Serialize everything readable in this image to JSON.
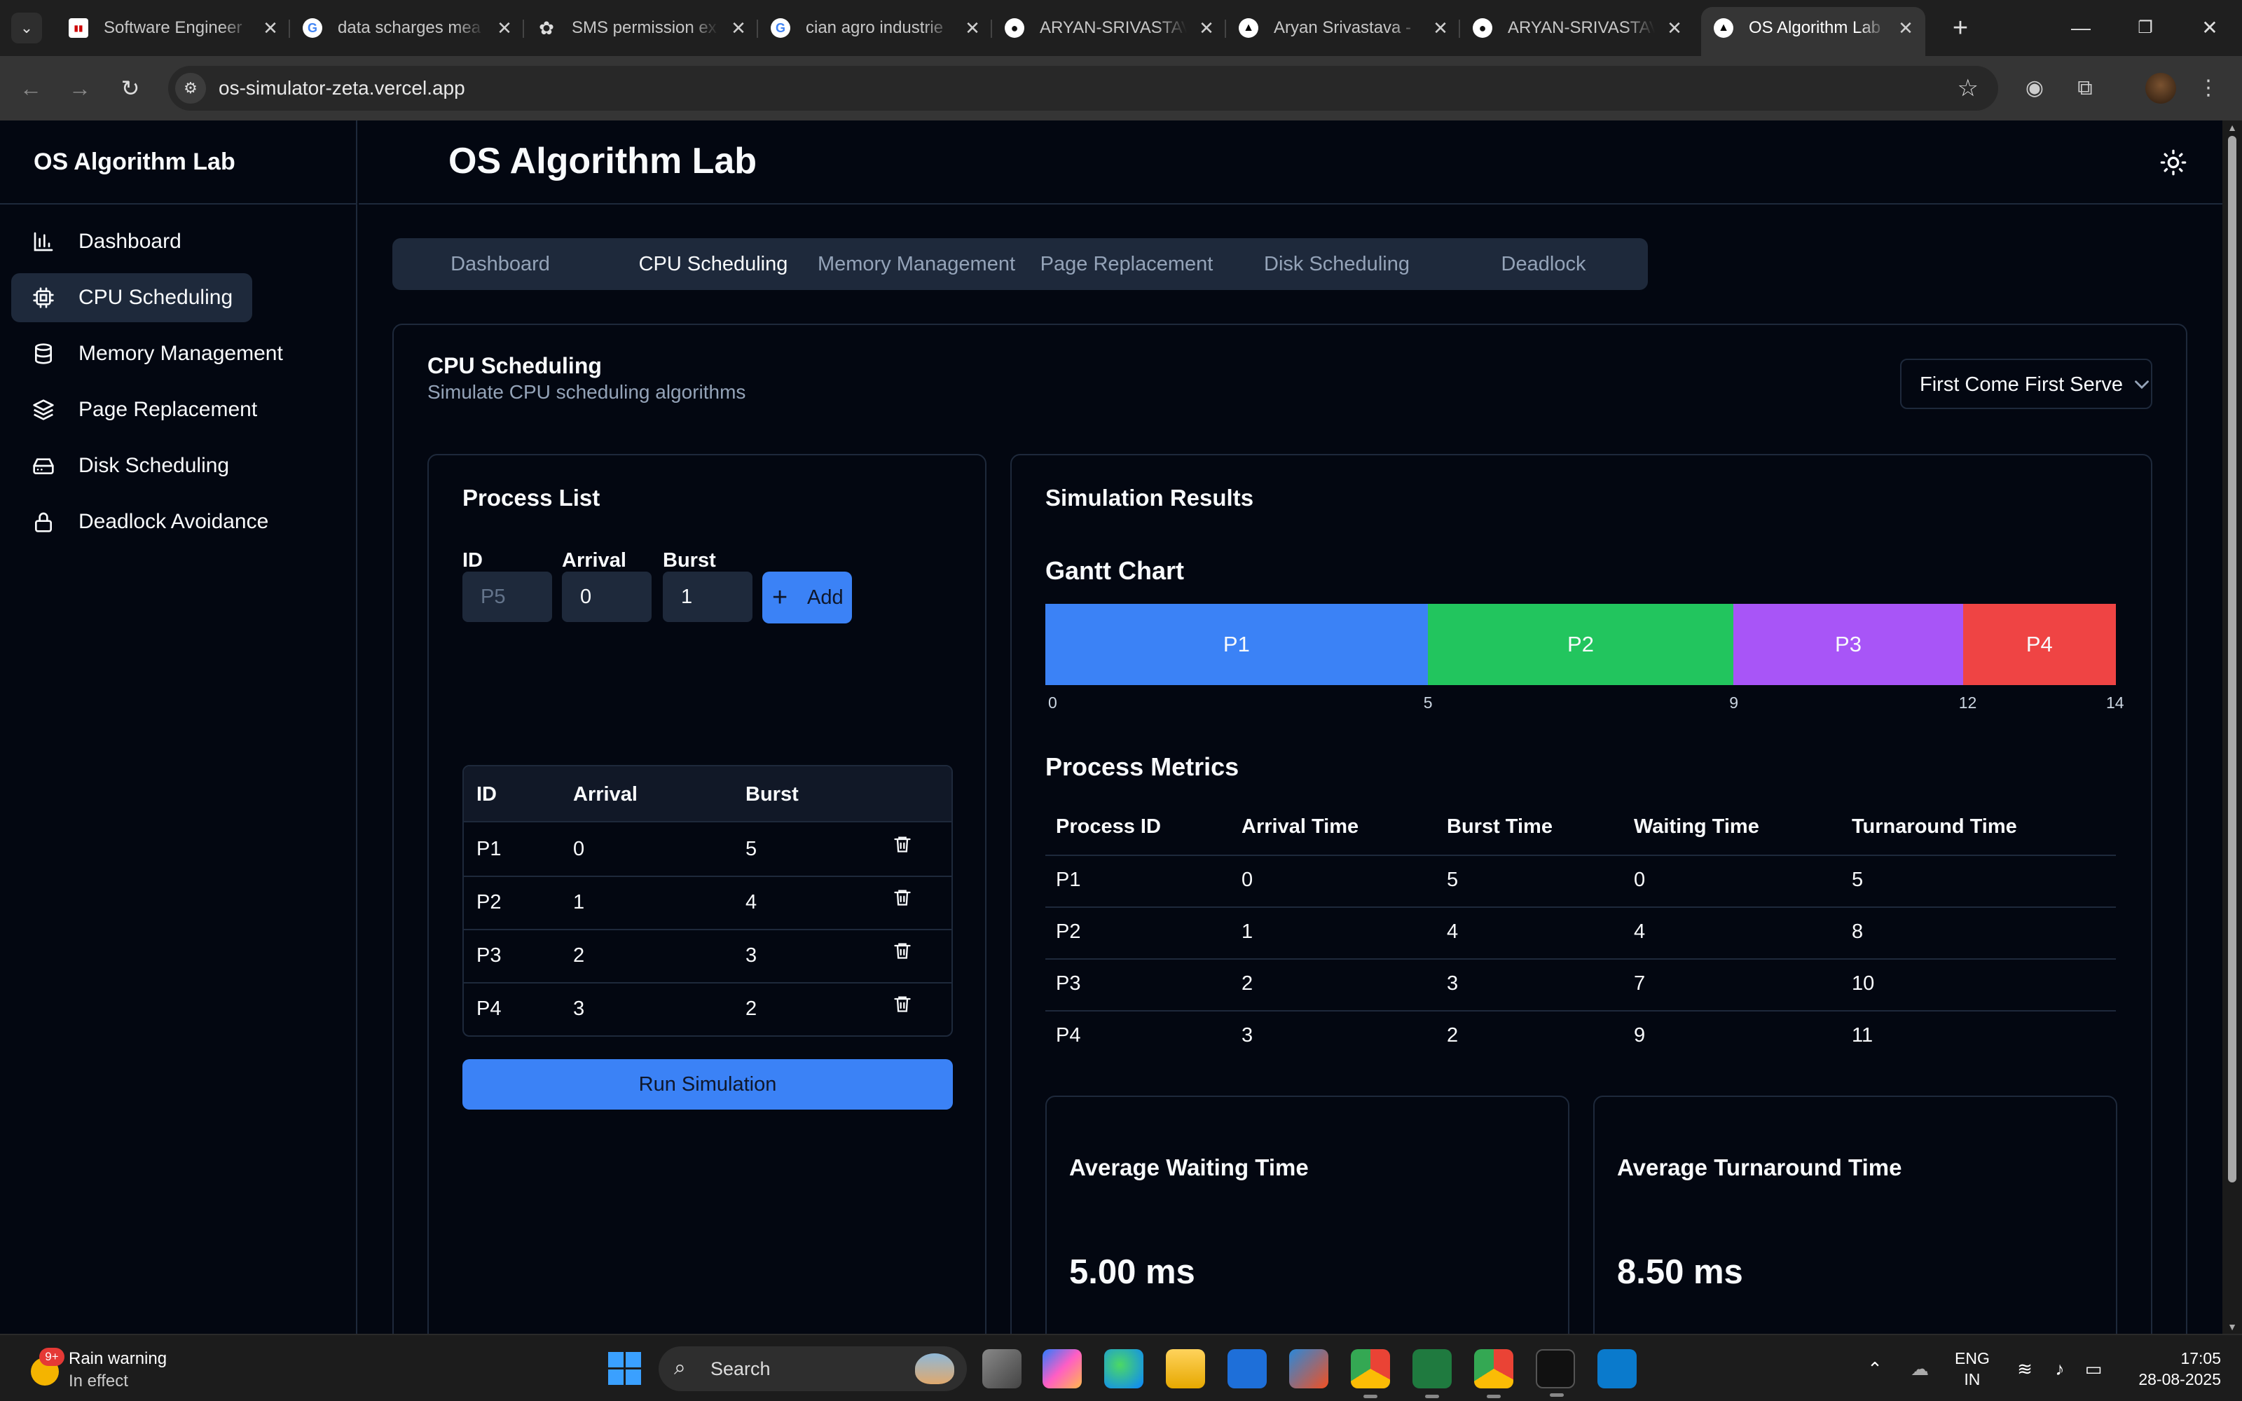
{
  "browser": {
    "tabs": [
      {
        "title": "Software Engineer",
        "favicon": "cisco-icon"
      },
      {
        "title": "data scharges mea",
        "favicon": "google-icon"
      },
      {
        "title": "SMS permission ex",
        "favicon": "openai-icon"
      },
      {
        "title": "cian agro industrie",
        "favicon": "google-icon"
      },
      {
        "title": "ARYAN-SRIVASTAV",
        "favicon": "github-icon"
      },
      {
        "title": "Aryan Srivastava -",
        "favicon": "vercel-icon"
      },
      {
        "title": "ARYAN-SRIVASTAV",
        "favicon": "github-icon"
      },
      {
        "title": "OS Algorithm Lab",
        "favicon": "vercel-icon",
        "active": true
      }
    ],
    "url": "os-simulator-zeta.vercel.app"
  },
  "sidebar": {
    "brand": "OS Algorithm Lab",
    "items": [
      {
        "label": "Dashboard",
        "icon": "bar-chart-icon"
      },
      {
        "label": "CPU Scheduling",
        "icon": "cpu-icon",
        "active": true
      },
      {
        "label": "Memory Management",
        "icon": "database-icon"
      },
      {
        "label": "Page Replacement",
        "icon": "layers-icon"
      },
      {
        "label": "Disk Scheduling",
        "icon": "hard-drive-icon"
      },
      {
        "label": "Deadlock Avoidance",
        "icon": "lock-icon"
      }
    ]
  },
  "header": {
    "title": "OS Algorithm Lab"
  },
  "tabs": [
    {
      "label": "Dashboard"
    },
    {
      "label": "CPU Scheduling",
      "active": true
    },
    {
      "label": "Memory Management"
    },
    {
      "label": "Page Replacement"
    },
    {
      "label": "Disk Scheduling"
    },
    {
      "label": "Deadlock"
    }
  ],
  "cpu": {
    "title": "CPU Scheduling",
    "subtitle": "Simulate CPU scheduling algorithms",
    "algorithm": "First Come First Serve"
  },
  "process_list": {
    "title": "Process List",
    "form": {
      "id_label": "ID",
      "id_placeholder": "P5",
      "arrival_label": "Arrival",
      "arrival_value": "0",
      "burst_label": "Burst",
      "burst_value": "1",
      "add_label": "Add"
    },
    "columns": [
      "ID",
      "Arrival",
      "Burst"
    ],
    "rows": [
      [
        "P1",
        "0",
        "5"
      ],
      [
        "P2",
        "1",
        "4"
      ],
      [
        "P3",
        "2",
        "3"
      ],
      [
        "P4",
        "3",
        "2"
      ]
    ],
    "run_label": "Run Simulation"
  },
  "results": {
    "title": "Simulation Results",
    "gantt_title": "Gantt Chart",
    "metrics_title": "Process Metrics",
    "metric_columns": [
      "Process ID",
      "Arrival Time",
      "Burst Time",
      "Waiting Time",
      "Turnaround Time"
    ],
    "metric_rows": [
      [
        "P1",
        "0",
        "5",
        "0",
        "5"
      ],
      [
        "P2",
        "1",
        "4",
        "4",
        "8"
      ],
      [
        "P3",
        "2",
        "3",
        "7",
        "10"
      ],
      [
        "P4",
        "3",
        "2",
        "9",
        "11"
      ]
    ],
    "avg_waiting_label": "Average Waiting Time",
    "avg_waiting_value": "5.00 ms",
    "avg_turnaround_label": "Average Turnaround Time",
    "avg_turnaround_value": "8.50 ms"
  },
  "colors": {
    "accent": "#3b82f6",
    "p1": "#3b82f6",
    "p2": "#22c55e",
    "p3": "#a855f7",
    "p4": "#ef4444"
  },
  "chart_data": {
    "type": "bar",
    "title": "Gantt Chart",
    "segments": [
      {
        "label": "P1",
        "start": 0,
        "end": 5
      },
      {
        "label": "P2",
        "start": 5,
        "end": 9
      },
      {
        "label": "P3",
        "start": 9,
        "end": 12
      },
      {
        "label": "P4",
        "start": 12,
        "end": 14
      }
    ],
    "ticks": [
      0,
      5,
      9,
      12,
      14
    ]
  },
  "taskbar": {
    "weather_title": "Rain warning",
    "weather_sub": "In effect",
    "weather_badge": "9+",
    "search": "Search",
    "lang_top": "ENG",
    "lang_bottom": "IN",
    "time": "17:05",
    "date": "28-08-2025"
  }
}
